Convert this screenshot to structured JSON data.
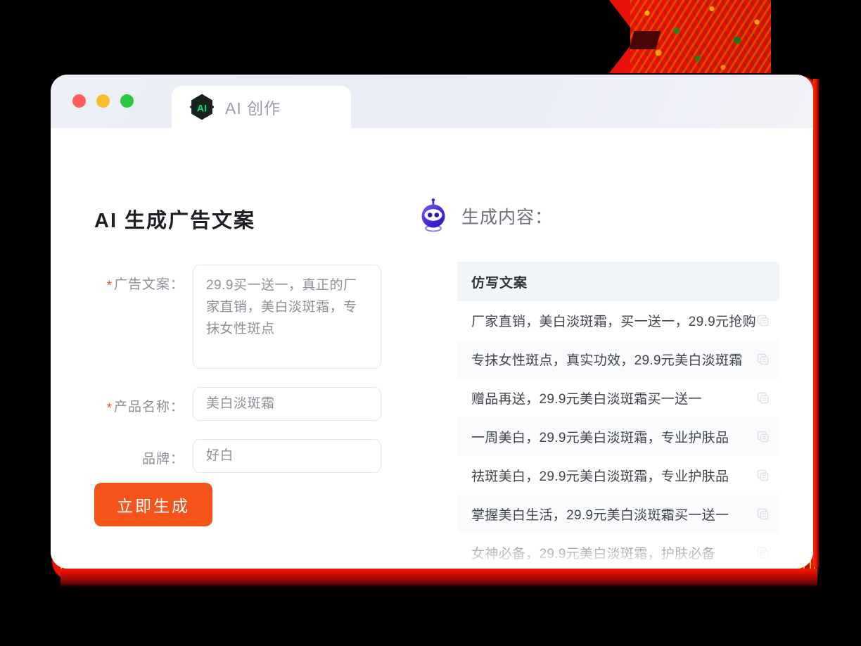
{
  "window": {
    "traffic_lights": [
      "close",
      "minimize",
      "maximize"
    ],
    "tab": {
      "label": "AI 创作",
      "logo_icon": "ai-hexagon-logo-icon",
      "logo_text": "AI"
    }
  },
  "left_panel": {
    "title": "AI 生成广告文案",
    "form": [
      {
        "label": "广告文案：",
        "required": true,
        "type": "textarea",
        "value": "29.9买一送一，真正的厂家直销，美白淡斑霜，专抹女性斑点"
      },
      {
        "label": "产品名称：",
        "required": true,
        "type": "input",
        "value": "美白淡斑霜"
      },
      {
        "label": "品牌：",
        "required": false,
        "type": "input",
        "value": "好白"
      }
    ],
    "submit_button": "立即生成"
  },
  "right_panel": {
    "robot_icon": "robot-head-icon",
    "heading": "生成内容：",
    "table": {
      "column_header": "仿写文案",
      "copy_icon": "copy-icon",
      "rows": [
        {
          "index": "1",
          "text": "厂家直销，美白淡斑霜，买一送一，29.9元抢购"
        },
        {
          "index": "2",
          "text": "专抹女性斑点，真实功效，29.9元美白淡斑霜"
        },
        {
          "index": "3",
          "text": "赠品再送，29.9元美白淡斑霜买一送一"
        },
        {
          "index": "4",
          "text": "一周美白，29.9元美白淡斑霜，专业护肤品"
        },
        {
          "index": "5",
          "text": "祛斑美白，29.9元美白淡斑霜，专业护肤品"
        },
        {
          "index": "6",
          "text": "掌握美白生活，29.9元美白淡斑霜买一送一"
        },
        {
          "index": "7",
          "text": "女神必备，29.9元美白淡斑霜，护肤必备"
        }
      ]
    }
  },
  "colors": {
    "accent_orange": "#f4531a",
    "required_star": "#f2532a",
    "logo_green": "#19d66f",
    "robot_blue": "#3d2fd6",
    "glow_red": "#ec1205",
    "table_header_bg": "#f2f5fa",
    "background": "#000000"
  }
}
